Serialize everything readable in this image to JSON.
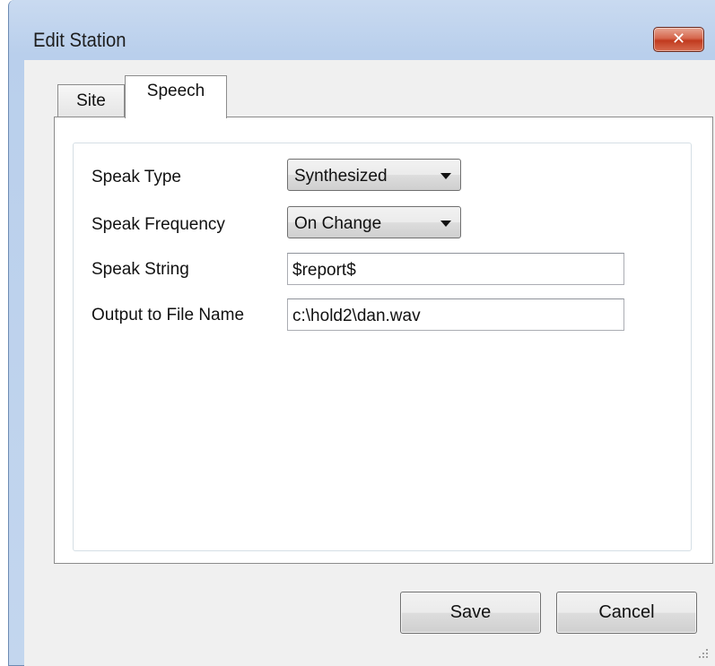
{
  "window": {
    "title": "Edit Station",
    "close_glyph": "✕"
  },
  "tabs": [
    {
      "label": "Site",
      "selected": false
    },
    {
      "label": "Speech",
      "selected": true
    }
  ],
  "form": {
    "speak_type": {
      "label": "Speak Type",
      "value": "Synthesized"
    },
    "speak_frequency": {
      "label": "Speak Frequency",
      "value": "On Change"
    },
    "speak_string": {
      "label": "Speak String",
      "value": "$report$"
    },
    "output_file": {
      "label": "Output to File Name",
      "value": "c:\\hold2\\dan.wav"
    }
  },
  "buttons": {
    "save": "Save",
    "cancel": "Cancel"
  },
  "colors": {
    "title_bar": "#b9cfec",
    "close_button": "#c13a1e",
    "dialog_background": "#f0f0f0"
  },
  "icons": {
    "close": "close-icon",
    "dropdown": "chevron-down-icon",
    "resize": "resize-grip-icon"
  }
}
